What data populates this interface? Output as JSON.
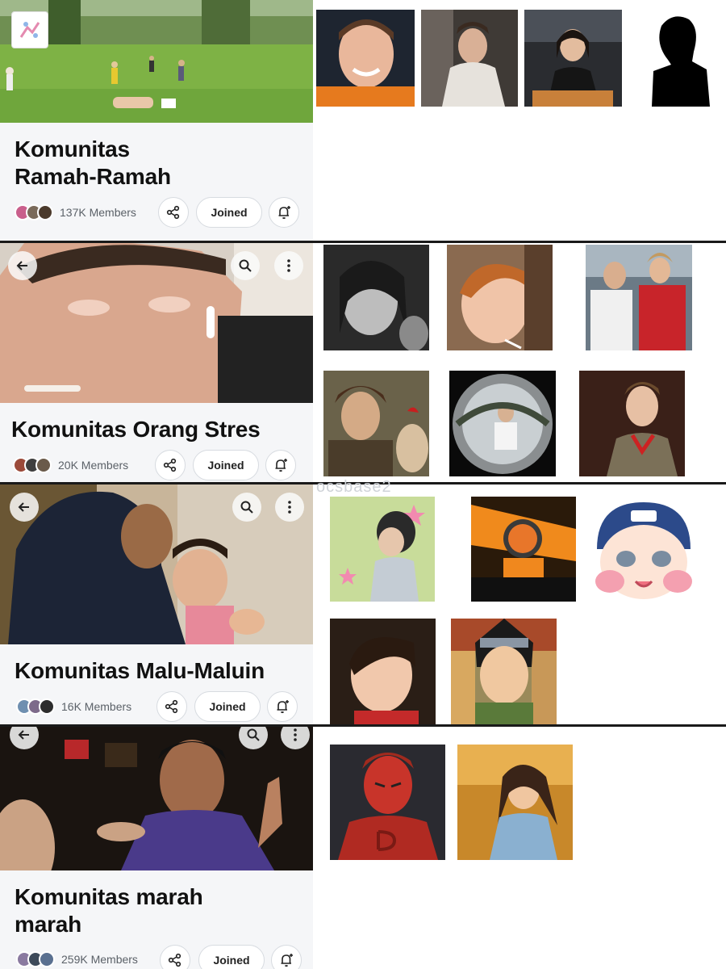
{
  "communities": [
    {
      "title": "Komunitas Ramah-Ramah",
      "title_lines": [
        "Komunitas",
        "Ramah-Ramah"
      ],
      "members": "137K Members",
      "joined_label": "Joined",
      "banner_icon": "park-scene",
      "avatar_colors": [
        "#c95f8c",
        "#7a6a5a",
        "#4b3a2c"
      ],
      "members_tiles": [
        "racing-driver-smiling",
        "man-white-hoodie",
        "woman-eating",
        "person-silhouette"
      ]
    },
    {
      "title": "Komunitas Orang Stres",
      "title_lines": [
        "Komunitas Orang Stres"
      ],
      "members": "20K Members",
      "joined_label": "Joined",
      "banner_icon": "crying-man",
      "avatar_colors": [
        "#9b4a3a",
        "#3f3f3f",
        "#6a5a4a"
      ],
      "members_tiles": [
        "woman-bw-portrait",
        "boy-with-straw",
        "drivers-in-paddock",
        "man-with-rooster",
        "fisheye-selfie",
        "young-man-blazer"
      ]
    },
    {
      "title": "Komunitas Malu-Maluin",
      "title_lines": [
        "Komunitas Malu-Maluin"
      ],
      "members": "16K Members",
      "joined_label": "Joined",
      "banner_icon": "woman-and-child",
      "avatar_colors": [
        "#6f8fb0",
        "#7d6a8a",
        "#2d2d2d"
      ],
      "members_tiles": [
        "drawn-man-stars",
        "driver-in-car",
        "chibi-driver-cap",
        "boy-portrait",
        "masked-ninja"
      ]
    },
    {
      "title": "Komunitas marah marah",
      "title_lines": [
        "Komunitas marah",
        "marah"
      ],
      "members": "259K Members",
      "joined_label": "Joined",
      "banner_icon": "angry-man-pointing",
      "avatar_colors": [
        "#8a7aa0",
        "#3d4a5a",
        "#5a7090"
      ],
      "members_tiles": [
        "red-masked-hero",
        "comic-girl-fire"
      ]
    }
  ],
  "watermark": "ocsbase2",
  "colors": {
    "card_bg": "#f5f6f8",
    "divider": "#1a1a1a",
    "title": "#111111",
    "meta": "#5b6168",
    "button_border": "#d7dbe0"
  }
}
